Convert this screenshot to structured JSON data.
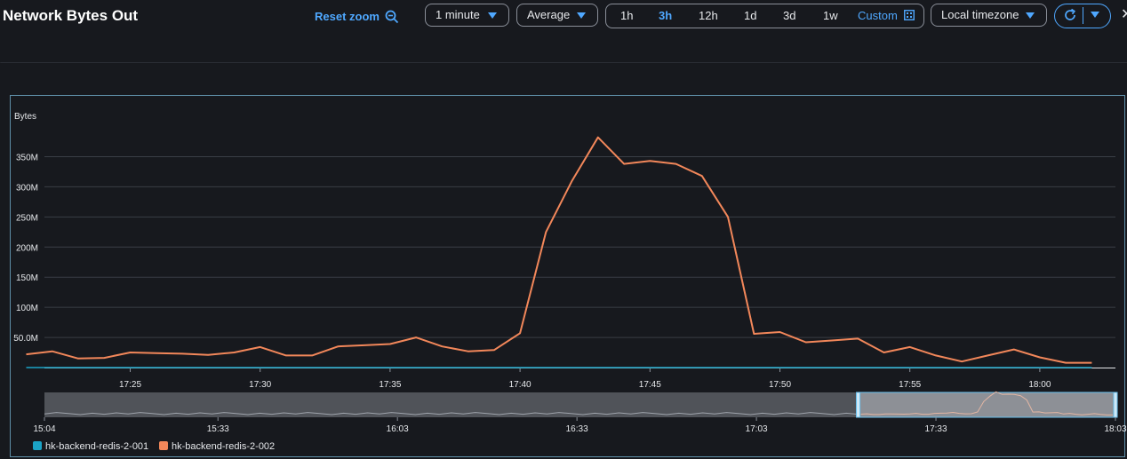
{
  "header": {
    "title": "Network Bytes Out",
    "reset_zoom": "Reset zoom",
    "period": "1 minute",
    "statistic": "Average",
    "ranges": [
      "1h",
      "3h",
      "12h",
      "1d",
      "3d",
      "1w"
    ],
    "active_range": "3h",
    "custom": "Custom",
    "timezone": "Local timezone"
  },
  "colors": {
    "accent": "#4fa8ff",
    "series_001": "#1ba3c6",
    "series_002": "#f2875a"
  },
  "icons": [
    "zoom-out-icon",
    "caret-down-icon",
    "calendar-icon",
    "refresh-icon",
    "close-icon"
  ],
  "chart_data": {
    "type": "line",
    "ylabel": "Bytes",
    "ylim": [
      0,
      375
    ],
    "y_unit": "M",
    "y_ticks": [
      "50.0M",
      "100M",
      "150M",
      "200M",
      "250M",
      "300M",
      "350M"
    ],
    "x_ticks": [
      "17:25",
      "17:30",
      "17:35",
      "17:40",
      "17:45",
      "17:50",
      "17:55",
      "18:00"
    ],
    "x": [
      "17:21",
      "17:22",
      "17:23",
      "17:24",
      "17:25",
      "17:26",
      "17:27",
      "17:28",
      "17:29",
      "17:30",
      "17:31",
      "17:32",
      "17:33",
      "17:34",
      "17:35",
      "17:36",
      "17:37",
      "17:38",
      "17:39",
      "17:40",
      "17:41",
      "17:42",
      "17:43",
      "17:44",
      "17:45",
      "17:46",
      "17:47",
      "17:48",
      "17:49",
      "17:50",
      "17:51",
      "17:52",
      "17:53",
      "17:54",
      "17:55",
      "17:56",
      "17:57",
      "17:58",
      "17:59",
      "18:00",
      "18:01",
      "18:02"
    ],
    "series": [
      {
        "name": "hk-backend-redis-2-001",
        "color": "#1ba3c6",
        "values": [
          0,
          0,
          0,
          0,
          0,
          0,
          0,
          0,
          0,
          0,
          0,
          0,
          0,
          0,
          0,
          0,
          0,
          0,
          0,
          0,
          0,
          0,
          0,
          0,
          0,
          0,
          0,
          0,
          0,
          0,
          0,
          0,
          0,
          0,
          0,
          0,
          0,
          0,
          0,
          0,
          0,
          0
        ]
      },
      {
        "name": "hk-backend-redis-2-002",
        "color": "#f2875a",
        "values": [
          22,
          27,
          15,
          16,
          25,
          24,
          23,
          21,
          25,
          34,
          20,
          20,
          35,
          37,
          39,
          50,
          35,
          27,
          29,
          57,
          225,
          310,
          382,
          338,
          343,
          338,
          318,
          250,
          56,
          59,
          42,
          45,
          48,
          25,
          34,
          20,
          10,
          20,
          30,
          17,
          8,
          8
        ]
      }
    ],
    "navigator": {
      "x_ticks": [
        "15:04",
        "15:33",
        "16:03",
        "16:33",
        "17:03",
        "17:33",
        "18:03"
      ],
      "selection": [
        "17:20",
        "18:03"
      ]
    },
    "legend_position": "bottom-left"
  }
}
